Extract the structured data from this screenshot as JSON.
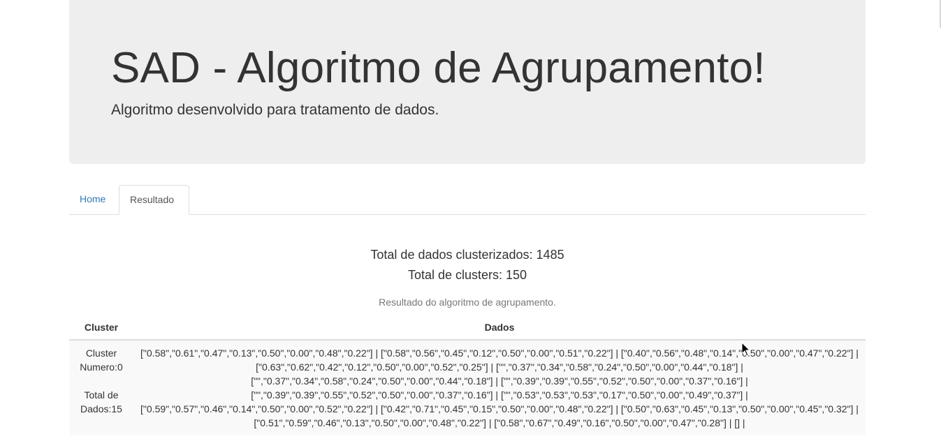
{
  "header": {
    "title": "SAD - Algoritmo de Agrupamento!",
    "subtitle": "Algoritmo desenvolvido para tratamento de dados."
  },
  "tabs": [
    {
      "label": "Home",
      "active": false
    },
    {
      "label": "Resultado",
      "active": true
    }
  ],
  "summary": {
    "total_dados": "Total de dados clusterizados: 1485",
    "total_clusters": "Total de clusters: 150"
  },
  "table": {
    "caption": "Resultado do algoritmo de agrupamento.",
    "headers": [
      "Cluster",
      "Dados"
    ],
    "rows": [
      {
        "cluster_line1": "Cluster",
        "cluster_line2": "Numero:0",
        "total_line1": "Total de",
        "total_line2": "Dados:15",
        "dados_lines": [
          "[\"0.58\",\"0.61\",\"0.47\",\"0.13\",\"0.50\",\"0.00\",\"0.48\",\"0.22\"] | [\"0.58\",\"0.56\",\"0.45\",\"0.12\",\"0.50\",\"0.00\",\"0.51\",\"0.22\"] | [\"0.40\",\"0.56\",\"0.48\",\"0.14\",\"0.50\",\"0.00\",\"0.47\",\"0.22\"] |",
          "[\"0.63\",\"0.62\",\"0.42\",\"0.12\",\"0.50\",\"0.00\",\"0.52\",\"0.25\"] | [\"\",\"0.37\",\"0.34\",\"0.58\",\"0.24\",\"0.50\",\"0.00\",\"0.44\",\"0.18\"] |",
          "[\"\",\"0.37\",\"0.34\",\"0.58\",\"0.24\",\"0.50\",\"0.00\",\"0.44\",\"0.18\"] | [\"\",\"0.39\",\"0.39\",\"0.55\",\"0.52\",\"0.50\",\"0.00\",\"0.37\",\"0.16\"] |",
          "[\"\",\"0.39\",\"0.39\",\"0.55\",\"0.52\",\"0.50\",\"0.00\",\"0.37\",\"0.16\"] | [\"\",\"0.53\",\"0.53\",\"0.53\",\"0.17\",\"0.50\",\"0.00\",\"0.49\",\"0.37\"] |",
          "[\"0.59\",\"0.57\",\"0.46\",\"0.14\",\"0.50\",\"0.00\",\"0.52\",\"0.22\"] | [\"0.42\",\"0.71\",\"0.45\",\"0.15\",\"0.50\",\"0.00\",\"0.48\",\"0.22\"] | [\"0.50\",\"0.63\",\"0.45\",\"0.13\",\"0.50\",\"0.00\",\"0.45\",\"0.32\"] |",
          "[\"0.51\",\"0.59\",\"0.46\",\"0.13\",\"0.50\",\"0.00\",\"0.48\",\"0.22\"] | [\"0.58\",\"0.67\",\"0.49\",\"0.16\",\"0.50\",\"0.00\",\"0.47\",\"0.28\"] | [] |"
        ]
      }
    ]
  },
  "icons": {
    "cursor": "mouse-pointer-icon"
  },
  "colors": {
    "jumbotron_bg": "#eeeeee",
    "link": "#337ab7",
    "row_bg": "#f9f9f9",
    "border": "#dddddd"
  }
}
